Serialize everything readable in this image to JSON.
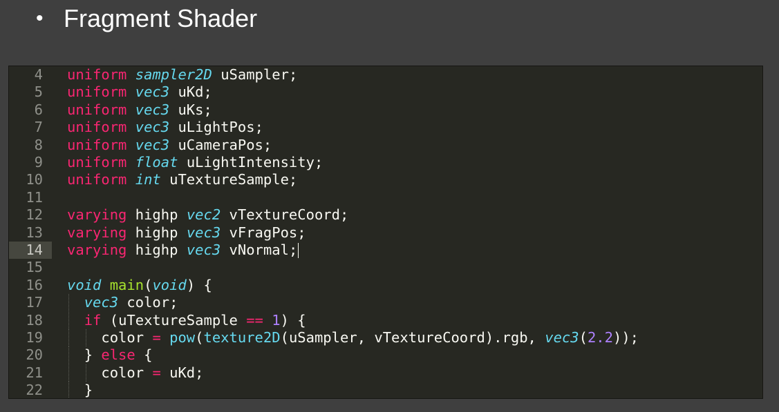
{
  "slide": {
    "bullet": "•",
    "title": "Fragment Shader"
  },
  "editor": {
    "active_line": "14",
    "lines": [
      {
        "number": "4",
        "tokens": [
          {
            "text": "uniform",
            "role": "keyword"
          },
          {
            "text": " ",
            "role": "space"
          },
          {
            "text": "sampler2D",
            "role": "type"
          },
          {
            "text": " ",
            "role": "space"
          },
          {
            "text": "uSampler",
            "role": "identifier"
          },
          {
            "text": ";",
            "role": "punctuation"
          }
        ]
      },
      {
        "number": "5",
        "tokens": [
          {
            "text": "uniform",
            "role": "keyword"
          },
          {
            "text": " ",
            "role": "space"
          },
          {
            "text": "vec3",
            "role": "type"
          },
          {
            "text": " ",
            "role": "space"
          },
          {
            "text": "uKd",
            "role": "identifier"
          },
          {
            "text": ";",
            "role": "punctuation"
          }
        ]
      },
      {
        "number": "6",
        "tokens": [
          {
            "text": "uniform",
            "role": "keyword"
          },
          {
            "text": " ",
            "role": "space"
          },
          {
            "text": "vec3",
            "role": "type"
          },
          {
            "text": " ",
            "role": "space"
          },
          {
            "text": "uKs",
            "role": "identifier"
          },
          {
            "text": ";",
            "role": "punctuation"
          }
        ]
      },
      {
        "number": "7",
        "tokens": [
          {
            "text": "uniform",
            "role": "keyword"
          },
          {
            "text": " ",
            "role": "space"
          },
          {
            "text": "vec3",
            "role": "type"
          },
          {
            "text": " ",
            "role": "space"
          },
          {
            "text": "uLightPos",
            "role": "identifier"
          },
          {
            "text": ";",
            "role": "punctuation"
          }
        ]
      },
      {
        "number": "8",
        "tokens": [
          {
            "text": "uniform",
            "role": "keyword"
          },
          {
            "text": " ",
            "role": "space"
          },
          {
            "text": "vec3",
            "role": "type"
          },
          {
            "text": " ",
            "role": "space"
          },
          {
            "text": "uCameraPos",
            "role": "identifier"
          },
          {
            "text": ";",
            "role": "punctuation"
          }
        ]
      },
      {
        "number": "9",
        "tokens": [
          {
            "text": "uniform",
            "role": "keyword"
          },
          {
            "text": " ",
            "role": "space"
          },
          {
            "text": "float",
            "role": "type"
          },
          {
            "text": " ",
            "role": "space"
          },
          {
            "text": "uLightIntensity",
            "role": "identifier"
          },
          {
            "text": ";",
            "role": "punctuation"
          }
        ]
      },
      {
        "number": "10",
        "tokens": [
          {
            "text": "uniform",
            "role": "keyword"
          },
          {
            "text": " ",
            "role": "space"
          },
          {
            "text": "int",
            "role": "type"
          },
          {
            "text": " ",
            "role": "space"
          },
          {
            "text": "uTextureSample",
            "role": "identifier"
          },
          {
            "text": ";",
            "role": "punctuation"
          }
        ]
      },
      {
        "number": "11",
        "tokens": []
      },
      {
        "number": "12",
        "tokens": [
          {
            "text": "varying",
            "role": "keyword"
          },
          {
            "text": " ",
            "role": "space"
          },
          {
            "text": "highp",
            "role": "identifier"
          },
          {
            "text": " ",
            "role": "space"
          },
          {
            "text": "vec2",
            "role": "type"
          },
          {
            "text": " ",
            "role": "space"
          },
          {
            "text": "vTextureCoord",
            "role": "identifier"
          },
          {
            "text": ";",
            "role": "punctuation"
          }
        ]
      },
      {
        "number": "13",
        "tokens": [
          {
            "text": "varying",
            "role": "keyword"
          },
          {
            "text": " ",
            "role": "space"
          },
          {
            "text": "highp",
            "role": "identifier"
          },
          {
            "text": " ",
            "role": "space"
          },
          {
            "text": "vec3",
            "role": "type"
          },
          {
            "text": " ",
            "role": "space"
          },
          {
            "text": "vFragPos",
            "role": "identifier"
          },
          {
            "text": ";",
            "role": "punctuation"
          }
        ]
      },
      {
        "number": "14",
        "tokens": [
          {
            "text": "varying",
            "role": "keyword"
          },
          {
            "text": " ",
            "role": "space"
          },
          {
            "text": "highp",
            "role": "identifier"
          },
          {
            "text": " ",
            "role": "space"
          },
          {
            "text": "vec3",
            "role": "type"
          },
          {
            "text": " ",
            "role": "space"
          },
          {
            "text": "vNormal",
            "role": "identifier"
          },
          {
            "text": ";",
            "role": "punctuation"
          }
        ]
      },
      {
        "number": "15",
        "tokens": []
      },
      {
        "number": "16",
        "tokens": [
          {
            "text": "void",
            "role": "type"
          },
          {
            "text": " ",
            "role": "space"
          },
          {
            "text": "main",
            "role": "function"
          },
          {
            "text": "(",
            "role": "punctuation"
          },
          {
            "text": "void",
            "role": "type"
          },
          {
            "text": ") {",
            "role": "punctuation"
          }
        ]
      },
      {
        "number": "17",
        "indent": 1,
        "tokens": [
          {
            "text": "vec3",
            "role": "type"
          },
          {
            "text": " ",
            "role": "space"
          },
          {
            "text": "color",
            "role": "identifier"
          },
          {
            "text": ";",
            "role": "punctuation"
          }
        ]
      },
      {
        "number": "18",
        "indent": 1,
        "tokens": [
          {
            "text": "if",
            "role": "keyword"
          },
          {
            "text": " ",
            "role": "space"
          },
          {
            "text": "(",
            "role": "punctuation"
          },
          {
            "text": "uTextureSample",
            "role": "identifier"
          },
          {
            "text": " ",
            "role": "space"
          },
          {
            "text": "==",
            "role": "operator"
          },
          {
            "text": " ",
            "role": "space"
          },
          {
            "text": "1",
            "role": "number"
          },
          {
            "text": ") {",
            "role": "punctuation"
          }
        ]
      },
      {
        "number": "19",
        "indent": 2,
        "tokens": [
          {
            "text": "color",
            "role": "identifier"
          },
          {
            "text": " ",
            "role": "space"
          },
          {
            "text": "=",
            "role": "operator"
          },
          {
            "text": " ",
            "role": "space"
          },
          {
            "text": "pow",
            "role": "builtin"
          },
          {
            "text": "(",
            "role": "punctuation"
          },
          {
            "text": "texture2D",
            "role": "builtin"
          },
          {
            "text": "(",
            "role": "punctuation"
          },
          {
            "text": "uSampler",
            "role": "identifier"
          },
          {
            "text": ", ",
            "role": "punctuation"
          },
          {
            "text": "vTextureCoord",
            "role": "identifier"
          },
          {
            "text": ").rgb, ",
            "role": "punctuation"
          },
          {
            "text": "vec3",
            "role": "type"
          },
          {
            "text": "(",
            "role": "punctuation"
          },
          {
            "text": "2.2",
            "role": "number"
          },
          {
            "text": "));",
            "role": "punctuation"
          }
        ]
      },
      {
        "number": "20",
        "indent": 1,
        "tokens": [
          {
            "text": "} ",
            "role": "punctuation"
          },
          {
            "text": "else",
            "role": "keyword"
          },
          {
            "text": " {",
            "role": "punctuation"
          }
        ]
      },
      {
        "number": "21",
        "indent": 2,
        "tokens": [
          {
            "text": "color",
            "role": "identifier"
          },
          {
            "text": " ",
            "role": "space"
          },
          {
            "text": "=",
            "role": "operator"
          },
          {
            "text": " ",
            "role": "space"
          },
          {
            "text": "uKd",
            "role": "identifier"
          },
          {
            "text": ";",
            "role": "punctuation"
          }
        ]
      },
      {
        "number": "22",
        "indent": 1,
        "tokens": [
          {
            "text": "}",
            "role": "punctuation"
          }
        ]
      }
    ]
  },
  "colors": {
    "slide_background": "#3f3f3f",
    "editor_background": "#272822",
    "keyword": "#f92672",
    "type": "#66d9ef",
    "function": "#a6e22e",
    "number": "#ae81ff",
    "text": "#f8f8f2",
    "line_number": "#8f908a"
  }
}
